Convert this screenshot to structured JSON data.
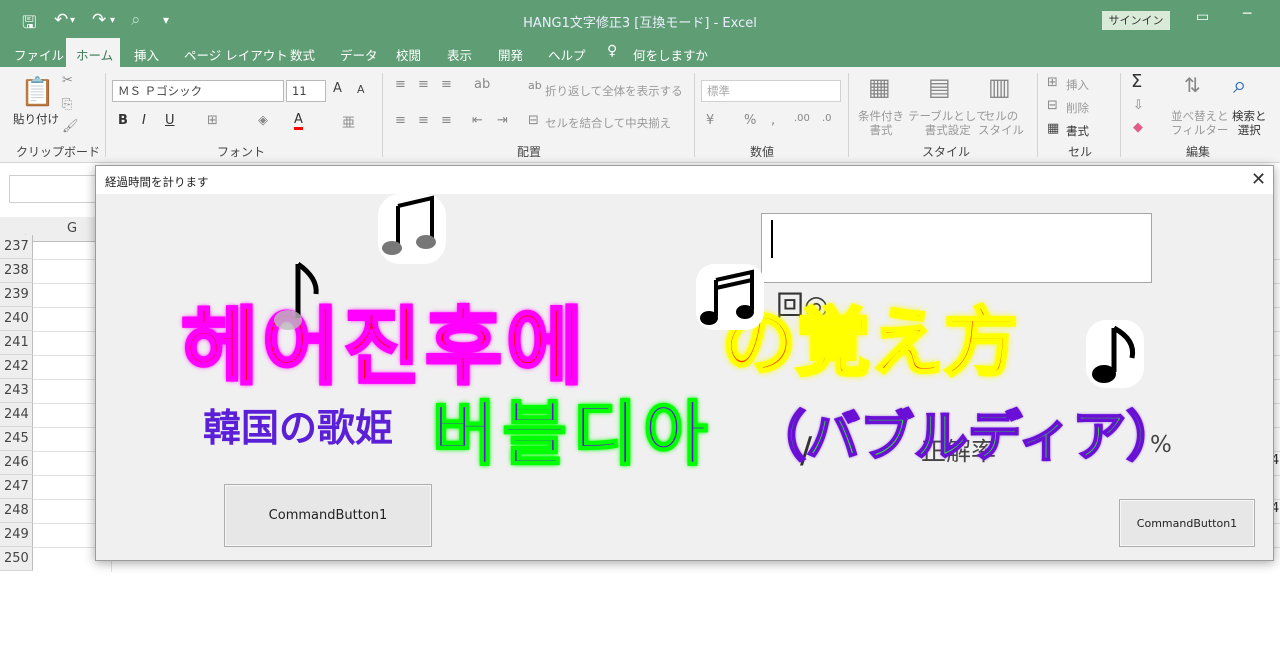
{
  "app": {
    "document_title": "HANG1文字修正3 [互換モード] - Excel",
    "sign_in": "サインイン"
  },
  "menu": [
    "ファイル",
    "ホーム",
    "挿入",
    "ページ レイアウト",
    "数式",
    "データ",
    "校閲",
    "表示",
    "開発",
    "ヘルプ",
    "何をしますか"
  ],
  "ribbon": {
    "groups": [
      "クリップボード",
      "フォント",
      "配置",
      "数値",
      "スタイル",
      "セル",
      "編集"
    ],
    "paste_label": "貼り付け",
    "font_name": "ＭＳ Ｐゴシック",
    "font_size": "11",
    "wrap_text": "折り返して全体を表示する",
    "merge_center": "セルを結合して中央揃え",
    "number_format": "標準",
    "conditional_format": "条件付き\n書式",
    "table_format": "テーブルとして\n書式設定",
    "cell_styles": "セルの\nスタイル",
    "insert": "挿入",
    "delete": "削除",
    "format": "書式",
    "sort_filter": "並べ替えと\nフィルター",
    "find_select": "検索と\n選択"
  },
  "sheet": {
    "column": "G",
    "rows": [
      "237",
      "238",
      "239",
      "240",
      "241",
      "242",
      "243",
      "244",
      "245",
      "246",
      "247",
      "248",
      "249",
      "250"
    ],
    "partial_cell_text": "4"
  },
  "dialog": {
    "title": "経過時間を計ります",
    "button_left": "CommandButton1",
    "button_right": "CommandButton1",
    "label_kai": "回◎",
    "label_seikai": "正解率",
    "label_percent": "%"
  },
  "overlay": {
    "korean_title": "헤어진후에",
    "oboekata": "の覚え方",
    "kankoku": "韓国の歌姫",
    "bubble_kr": "버블디아",
    "bubble_ja": "（バブルディア）"
  },
  "colors": {
    "excel_green": "#5f9e75",
    "title_red": "#ff0000",
    "title_magenta": "#ff00ff",
    "orange": "#ff4500",
    "yellow": "#ffff00",
    "purple": "#6a0fd6",
    "green": "#2ee32e"
  },
  "icons": [
    "save-icon",
    "undo-icon",
    "redo-icon",
    "print-preview-icon",
    "qat-more-icon",
    "lightbulb-icon",
    "close-icon",
    "music-note-icon"
  ]
}
